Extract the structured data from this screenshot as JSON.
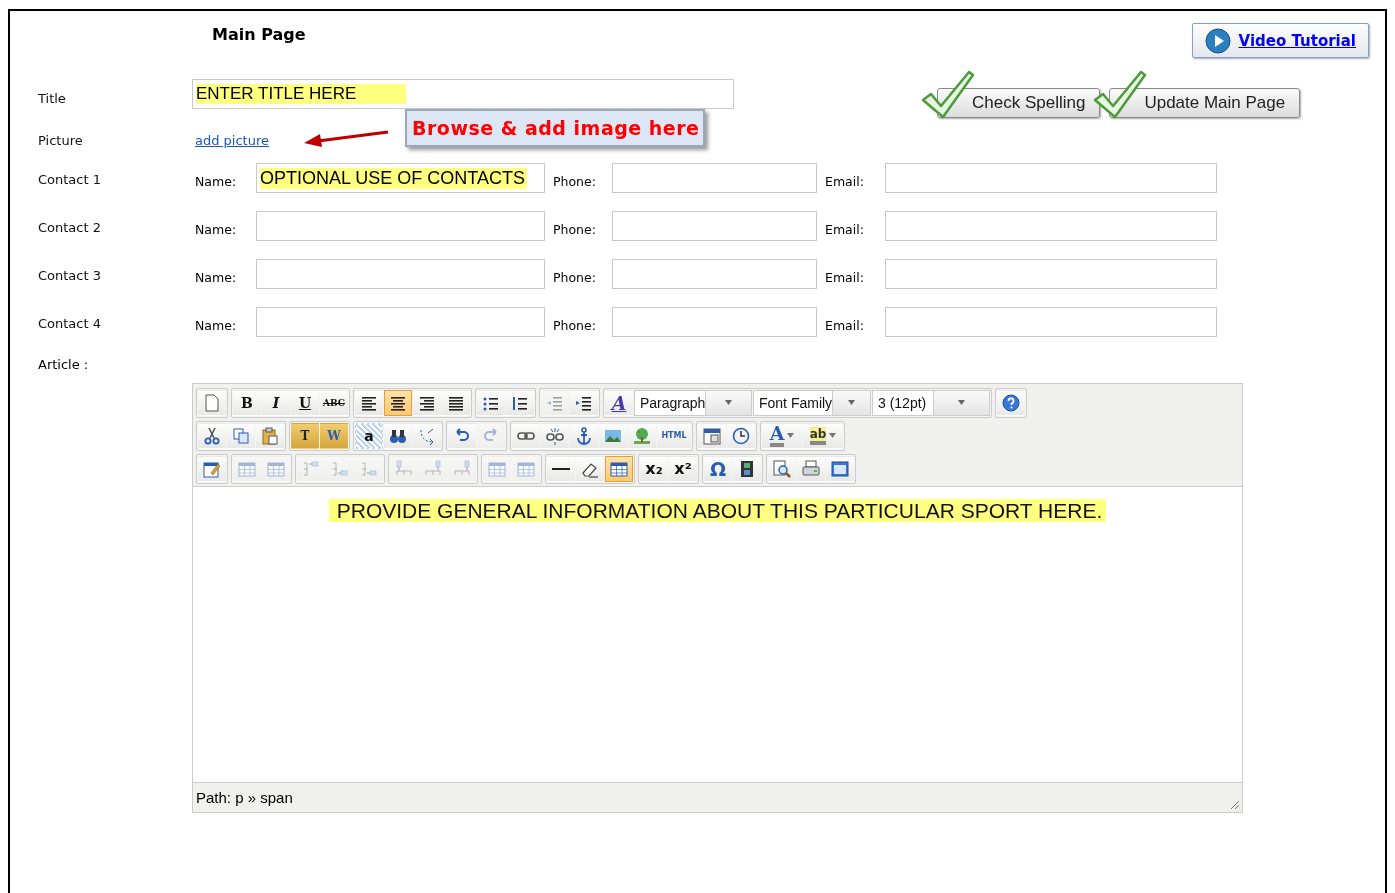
{
  "page_title": "Main Page",
  "video_tutorial": "Video Tutorial",
  "actions": [
    {
      "label": "Check Spelling"
    },
    {
      "label": "Update Main Page"
    }
  ],
  "title": {
    "label": "Title",
    "value": "ENTER TITLE HERE"
  },
  "picture": {
    "label": "Picture",
    "link": "add picture",
    "callout": "Browse & add image here"
  },
  "contacts": [
    {
      "label": "Contact 1",
      "name_label": "Name:",
      "name": "OPTIONAL USE OF CONTACTS",
      "phone_label": "Phone:",
      "email_label": "Email:"
    },
    {
      "label": "Contact 2",
      "name_label": "Name:",
      "phone_label": "Phone:",
      "email_label": "Email:"
    },
    {
      "label": "Contact 3",
      "name_label": "Name:",
      "phone_label": "Phone:",
      "email_label": "Email:"
    },
    {
      "label": "Contact 4",
      "name_label": "Name:",
      "phone_label": "Phone:",
      "email_label": "Email:"
    }
  ],
  "article": {
    "label": "Article :",
    "toolbar": [
      [
        [
          {
            "kind": "new",
            "disabled": false,
            "selected": false
          }
        ],
        [
          {
            "kind": "bold",
            "label": "B",
            "disabled": false,
            "selected": false
          },
          {
            "kind": "italic",
            "label": "I",
            "disabled": false,
            "selected": false
          },
          {
            "kind": "underline",
            "label": "U",
            "disabled": false,
            "selected": false
          },
          {
            "kind": "strike",
            "label": "ABC",
            "disabled": false,
            "selected": false
          }
        ],
        [
          {
            "kind": "alignleft",
            "disabled": false,
            "selected": false
          },
          {
            "kind": "aligncenter",
            "disabled": false,
            "selected": true
          },
          {
            "kind": "alignright",
            "disabled": false,
            "selected": false
          },
          {
            "kind": "justify",
            "disabled": false,
            "selected": false
          }
        ],
        [
          {
            "kind": "bullist",
            "disabled": false,
            "selected": false
          },
          {
            "kind": "numlist",
            "disabled": false,
            "selected": false
          }
        ],
        [
          {
            "kind": "outdent",
            "disabled": true,
            "selected": false
          },
          {
            "kind": "indent",
            "disabled": false,
            "selected": false
          }
        ],
        [
          {
            "kind": "styleprops",
            "label": "A",
            "disabled": false,
            "selected": false
          },
          {
            "kind": "select",
            "value": "Paragraph"
          },
          {
            "kind": "select",
            "value": "Font Family"
          },
          {
            "kind": "select",
            "value": "3 (12pt)"
          }
        ],
        [
          {
            "kind": "help",
            "disabled": false,
            "selected": false
          }
        ]
      ],
      [
        [
          {
            "kind": "cut",
            "disabled": false,
            "selected": false
          },
          {
            "kind": "copy",
            "disabled": false,
            "selected": false
          },
          {
            "kind": "paste",
            "disabled": false,
            "selected": false
          }
        ],
        [
          {
            "kind": "pastetext",
            "label": "T",
            "disabled": false,
            "selected": false
          },
          {
            "kind": "pasteword",
            "label": "W",
            "disabled": false,
            "selected": false
          }
        ],
        [
          {
            "kind": "selectall",
            "label": "a",
            "disabled": false,
            "selected": false
          },
          {
            "kind": "search",
            "disabled": false,
            "selected": false
          },
          {
            "kind": "replace",
            "disabled": false,
            "selected": false
          }
        ],
        [
          {
            "kind": "undo",
            "disabled": false,
            "selected": false
          },
          {
            "kind": "redo",
            "disabled": true,
            "selected": false
          }
        ],
        [
          {
            "kind": "link",
            "disabled": false,
            "selected": false
          },
          {
            "kind": "unlink",
            "disabled": false,
            "selected": false
          },
          {
            "kind": "anchor",
            "disabled": false,
            "selected": false
          },
          {
            "kind": "image",
            "disabled": false,
            "selected": false
          },
          {
            "kind": "tree",
            "disabled": false,
            "selected": false
          },
          {
            "kind": "html",
            "label": "HTML",
            "disabled": false,
            "selected": false
          }
        ],
        [
          {
            "kind": "date",
            "disabled": false,
            "selected": false
          },
          {
            "kind": "time",
            "disabled": false,
            "selected": false
          }
        ],
        [
          {
            "kind": "forecolor",
            "label": "A",
            "disabled": false,
            "selected": false
          },
          {
            "kind": "backcolor",
            "label": "ab",
            "disabled": false,
            "selected": false
          }
        ]
      ],
      [
        [
          {
            "kind": "edit",
            "disabled": false,
            "selected": false
          }
        ],
        [
          {
            "kind": "tablerow",
            "disabled": true,
            "selected": false
          },
          {
            "kind": "tablecell",
            "disabled": true,
            "selected": false
          }
        ],
        [
          {
            "kind": "rowbefore",
            "disabled": true,
            "selected": false
          },
          {
            "kind": "rowafter",
            "disabled": true,
            "selected": false
          },
          {
            "kind": "deleterow",
            "disabled": true,
            "selected": false
          }
        ],
        [
          {
            "kind": "colbefore",
            "disabled": true,
            "selected": false
          },
          {
            "kind": "colafter",
            "disabled": true,
            "selected": false
          },
          {
            "kind": "deletecol",
            "disabled": true,
            "selected": false
          }
        ],
        [
          {
            "kind": "merge",
            "disabled": true,
            "selected": false
          },
          {
            "kind": "split",
            "disabled": true,
            "selected": false
          }
        ],
        [
          {
            "kind": "hr",
            "disabled": false,
            "selected": false
          },
          {
            "kind": "eraser",
            "disabled": false,
            "selected": false
          },
          {
            "kind": "table",
            "disabled": false,
            "selected": true
          }
        ],
        [
          {
            "kind": "sub",
            "label": "x₂",
            "disabled": false,
            "selected": false
          },
          {
            "kind": "sup",
            "label": "x²",
            "disabled": false,
            "selected": false
          }
        ],
        [
          {
            "kind": "charmap",
            "label": "Ω",
            "disabled": false,
            "selected": false
          },
          {
            "kind": "film",
            "disabled": false,
            "selected": false
          }
        ],
        [
          {
            "kind": "preview",
            "disabled": false,
            "selected": false
          },
          {
            "kind": "print",
            "disabled": false,
            "selected": false
          },
          {
            "kind": "fullscreen",
            "disabled": false,
            "selected": false
          }
        ]
      ]
    ],
    "content": "PROVIDE GENERAL INFORMATION ABOUT THIS PARTICULAR SPORT HERE.",
    "path": "Path: p » span"
  }
}
